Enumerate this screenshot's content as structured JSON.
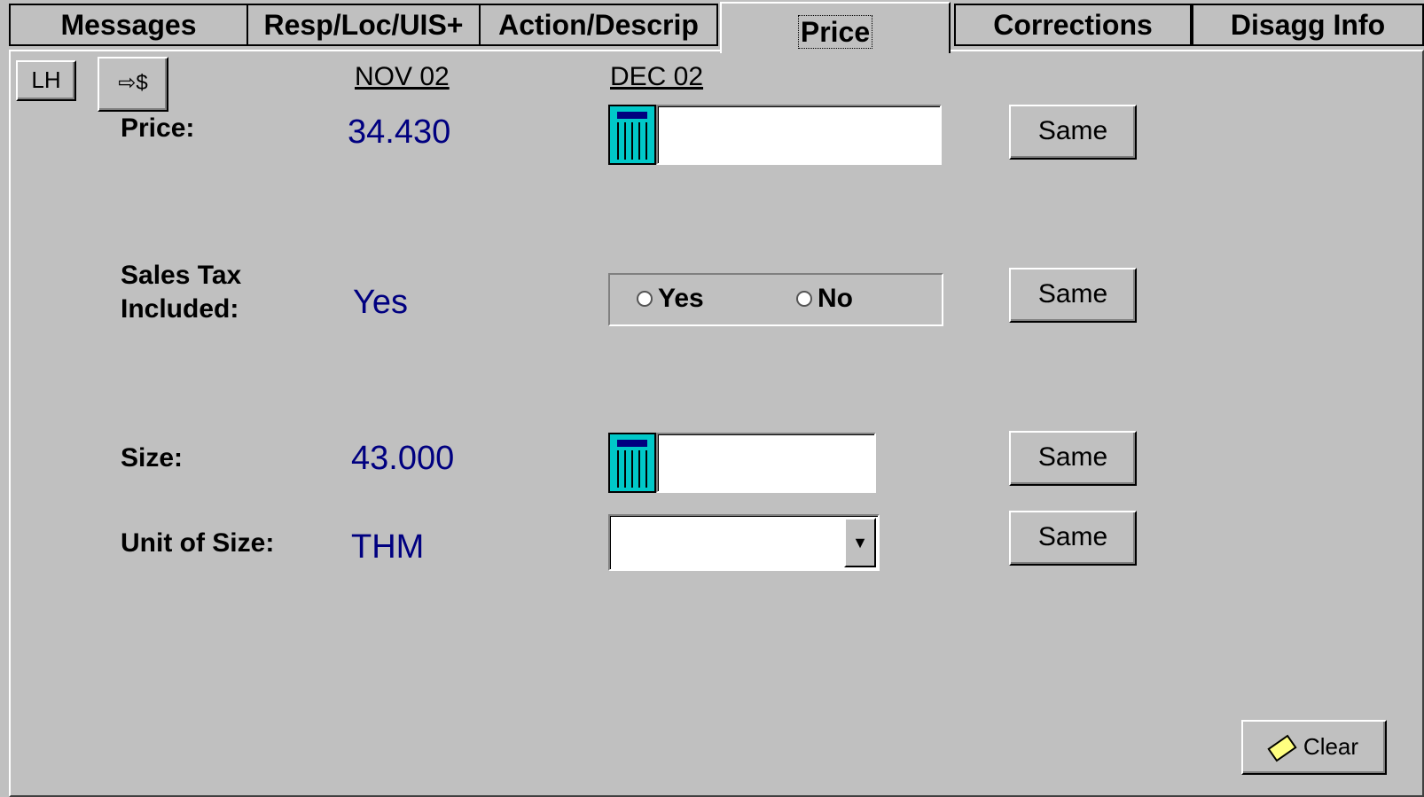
{
  "tabs": [
    {
      "label": "Messages"
    },
    {
      "label": "Resp/Loc/UIS+"
    },
    {
      "label": "Action/Descrip"
    },
    {
      "label": "Price"
    },
    {
      "label": "Corrections"
    },
    {
      "label": "Disagg Info"
    }
  ],
  "active_tab": "Price",
  "toolbar": {
    "lh_label": "LH",
    "to_dollar_label": "⇨$"
  },
  "columns": {
    "prior": "NOV 02",
    "current": "DEC 02"
  },
  "fields": {
    "price": {
      "label": "Price:",
      "prior_value": "34.430",
      "current_value": "",
      "same_label": "Same"
    },
    "sales_tax": {
      "label_line1": "Sales Tax",
      "label_line2": "Included:",
      "prior_value": "Yes",
      "option_yes": "Yes",
      "option_no": "No",
      "same_label": "Same"
    },
    "size": {
      "label": "Size:",
      "prior_value": "43.000",
      "current_value": "",
      "same_label": "Same"
    },
    "unit_of_size": {
      "label": "Unit of Size:",
      "prior_value": "THM",
      "current_value": "",
      "same_label": "Same"
    }
  },
  "clear_button": {
    "label": "Clear",
    "icon": "eraser-icon"
  },
  "colors": {
    "background": "#c0c0c0",
    "value_text": "#000080",
    "calculator": "#00c8c8"
  }
}
